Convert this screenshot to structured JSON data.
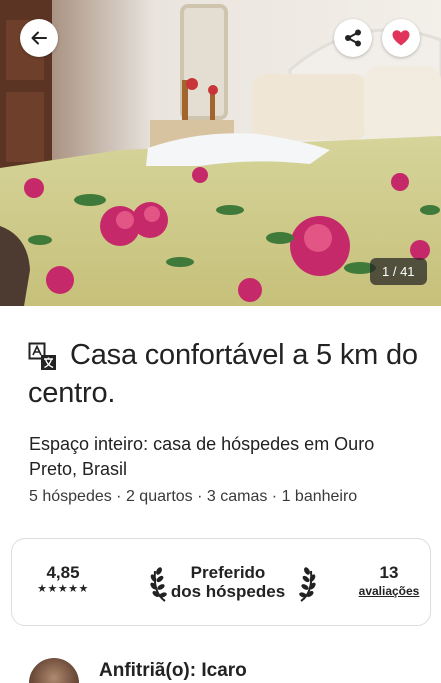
{
  "hero": {
    "photo_counter": "1 / 41",
    "back_icon": "arrow-left-icon",
    "share_icon": "share-icon",
    "favorite_icon": "heart-icon",
    "favorite_color": "#e0345a"
  },
  "listing": {
    "translate_icon": "translate-icon",
    "title": "Casa confortável a 5 km do centro.",
    "subtitle": "Espaço inteiro: casa de hóspedes em Ouro Preto, Brasil",
    "details": "5 hóspedes · 2 quartos · 3 camas · 1 banheiro"
  },
  "stats": {
    "rating": "4,85",
    "stars": "★★★★★",
    "rating_stars_count": 5,
    "guest_favorite_line1": "Preferido",
    "guest_favorite_line2": "dos hóspedes",
    "reviews_count": "13",
    "reviews_label": "avaliações"
  },
  "host": {
    "label": "Anfitriã(o): Icaro"
  }
}
